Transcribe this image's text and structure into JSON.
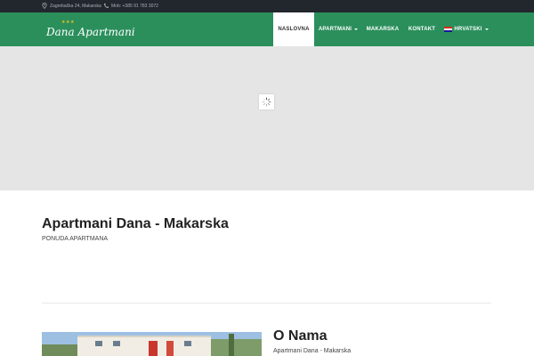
{
  "topbar": {
    "address": "Zagrebačka 24, Makarska",
    "phone": "Mob: +385 91 783 3072"
  },
  "brand": {
    "stars": "★★★",
    "name": "Dana Apartmani"
  },
  "nav": {
    "items": [
      {
        "label": "NASLOVNA",
        "active": true
      },
      {
        "label": "APARTMANI",
        "has_dropdown": true
      },
      {
        "label": "MAKARSKA"
      },
      {
        "label": "KONTAKT"
      },
      {
        "label": "HRVATSKI",
        "has_dropdown": true,
        "icon": "croatia-flag-icon"
      }
    ]
  },
  "main": {
    "title": "Apartmani Dana - Makarska",
    "subtitle": "PONUDA APARTMANA"
  },
  "about": {
    "title": "O Nama",
    "subtitle": "Apartmani Dana - Makarska"
  },
  "colors": {
    "topbar": "#22262d",
    "nav": "#2b8f5c",
    "hero_placeholder": "#e5e5e5",
    "stars": "#f0c419"
  }
}
